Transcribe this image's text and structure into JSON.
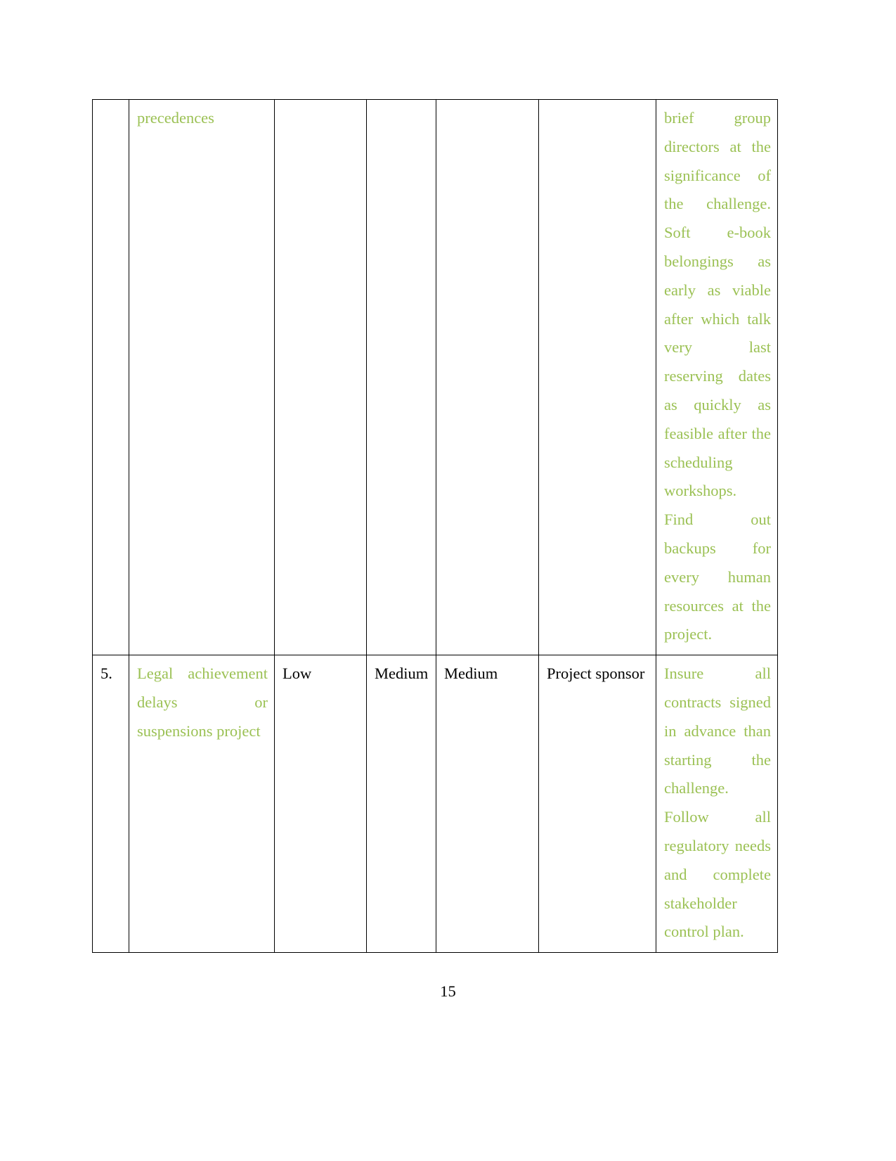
{
  "document": {
    "page_number": "15",
    "colors": {
      "green_text": "#9bc154",
      "black_text": "#000000",
      "border": "#000000",
      "background": "#ffffff"
    }
  },
  "table": {
    "rows": [
      {
        "number": "",
        "risk": "precedences",
        "probability": "",
        "impact": "",
        "severity": "",
        "owner": "",
        "mitigation_lines": [
          "brief group",
          "directors at the",
          "significance of",
          "the challenge.",
          "Soft e-book",
          "belongings as",
          "early as viable",
          "after which talk",
          "very last",
          "reserving dates",
          "as quickly as",
          "feasible after",
          "the scheduling",
          "workshops.",
          "Find out",
          "backups for",
          "every human",
          "resources at the",
          "project."
        ],
        "mitigation_paragraphs": [
          "brief group directors at the significance of the challenge. Soft e-book belongings as early as viable after which talk very last reserving dates as quickly as feasible after the scheduling workshops.",
          "Find out backups for every human resources at the project."
        ]
      },
      {
        "number": "5.",
        "risk": "Legal achievement delays or suspensions project",
        "risk_lines": [
          "Legal achievement",
          "delays or",
          "suspensions project"
        ],
        "probability": "Low",
        "impact": "Medium",
        "impact_lines": [
          "Mediu",
          "m"
        ],
        "severity": "Medium",
        "owner": "Project sponsor",
        "owner_lines": [
          "Project",
          "sponsor"
        ],
        "mitigation_lines": [
          "Insure all",
          "contracts signed",
          "in advance than",
          "starting the",
          "challenge.",
          "Follow all",
          "regulatory",
          "needs and",
          "complete",
          "stakeholder",
          "control plan."
        ],
        "mitigation_paragraphs": [
          "Insure all contracts signed in advance than starting the challenge.",
          "Follow all regulatory needs and complete stakeholder control plan."
        ]
      }
    ]
  }
}
